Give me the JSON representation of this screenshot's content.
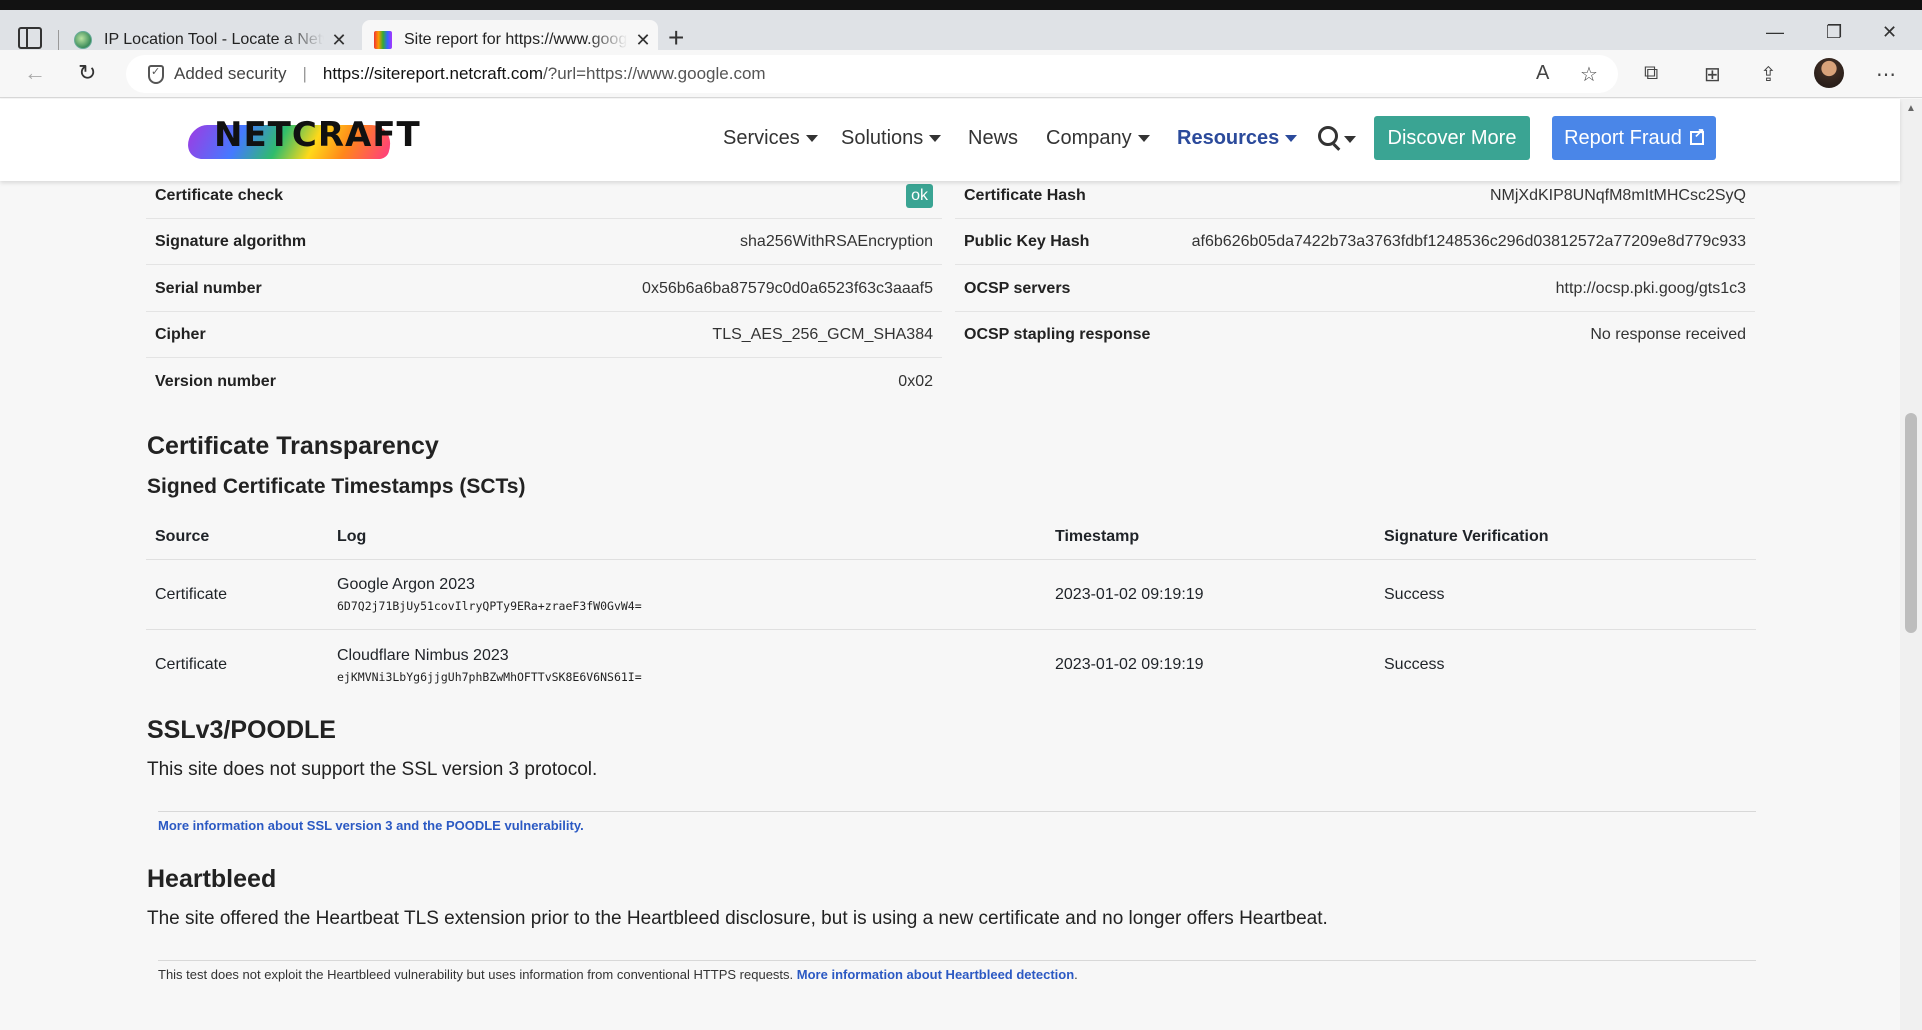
{
  "browser": {
    "tabs": [
      {
        "title": "IP Location Tool - Locate a Network"
      },
      {
        "title": "Site report for https://www.google.com"
      }
    ],
    "security_label": "Added security",
    "url_host": "https://sitereport.netcraft.com",
    "url_path": "/?url=https://www.google.com"
  },
  "site_nav": {
    "logo_text": "NETCRAFT",
    "items": [
      "Services",
      "Solutions",
      "News",
      "Company",
      "Resources"
    ],
    "discover_label": "Discover More",
    "fraud_label": "Report Fraud"
  },
  "cert_left": [
    {
      "key": "Certificate check",
      "value": "ok"
    },
    {
      "key": "Signature algorithm",
      "value": "sha256WithRSAEncryption"
    },
    {
      "key": "Serial number",
      "value": "0x56b6a6ba87579c0d0a6523f63c3aaaf5"
    },
    {
      "key": "Cipher",
      "value": "TLS_AES_256_GCM_SHA384"
    },
    {
      "key": "Version number",
      "value": "0x02"
    }
  ],
  "cert_right": [
    {
      "key": "Certificate Hash",
      "value": "NMjXdKIP8UNqfM8mItMHCsc2SyQ"
    },
    {
      "key": "Public Key Hash",
      "value": "af6b626b05da7422b73a3763fdbf1248536c296d03812572a77209e8d779c933"
    },
    {
      "key": "OCSP servers",
      "value": "http://ocsp.pki.goog/gts1c3"
    },
    {
      "key": "OCSP stapling response",
      "value": "No response received"
    }
  ],
  "ct": {
    "heading": "Certificate Transparency",
    "subheading": "Signed Certificate Timestamps (SCTs)",
    "columns": [
      "Source",
      "Log",
      "Timestamp",
      "Signature Verification"
    ],
    "rows": [
      {
        "source": "Certificate",
        "log": "Google Argon 2023",
        "log_id": "6D7Q2j71BjUy51covIlryQPTy9ERa+zraeF3fW0GvW4=",
        "timestamp": "2023-01-02 09:19:19",
        "verification": "Success"
      },
      {
        "source": "Certificate",
        "log": "Cloudflare Nimbus 2023",
        "log_id": "ejKMVNi3LbYg6jjgUh7phBZwMhOFTTvSK8E6V6NS61I=",
        "timestamp": "2023-01-02 09:19:19",
        "verification": "Success"
      }
    ]
  },
  "poodle": {
    "heading": "SSLv3/POODLE",
    "text": "This site does not support the SSL version 3 protocol.",
    "link": "More information about SSL version 3 and the POODLE vulnerability."
  },
  "heartbleed": {
    "heading": "Heartbleed",
    "text": "The site offered the Heartbeat TLS extension prior to the Heartbleed disclosure, but is using a new certificate and no longer offers Heartbeat.",
    "note": "This test does not exploit the Heartbleed vulnerability but uses information from conventional HTTPS requests.",
    "link": "More information about Heartbleed detection",
    "link_suffix": "."
  }
}
